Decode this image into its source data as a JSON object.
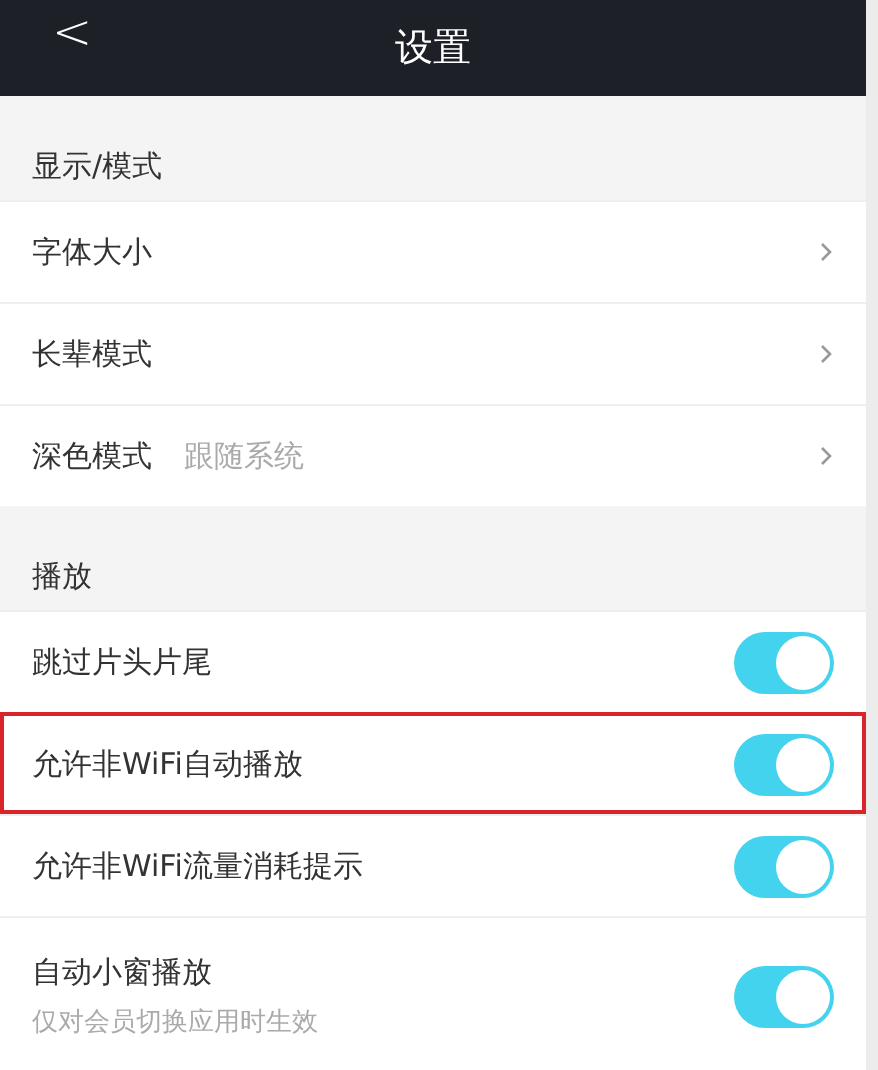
{
  "header": {
    "back": "<",
    "title": "设置"
  },
  "sections": [
    {
      "title": "显示/模式",
      "items": [
        {
          "kind": "link",
          "label": "字体大小",
          "highlighted": false
        },
        {
          "kind": "link",
          "label": "长辈模式",
          "highlighted": false
        },
        {
          "kind": "link",
          "label": "深色模式",
          "value": "跟随系统",
          "highlighted": false
        }
      ]
    },
    {
      "title": "播放",
      "items": [
        {
          "kind": "toggle",
          "label": "跳过片头片尾",
          "on": true,
          "highlighted": false
        },
        {
          "kind": "toggle",
          "label": "允许非WiFi自动播放",
          "on": true,
          "highlighted": true
        },
        {
          "kind": "toggle",
          "label": "允许非WiFi流量消耗提示",
          "on": true,
          "highlighted": false
        },
        {
          "kind": "toggle",
          "label": "自动小窗播放",
          "subtitle": "仅对会员切换应用时生效",
          "on": true,
          "highlighted": false
        }
      ]
    }
  ]
}
